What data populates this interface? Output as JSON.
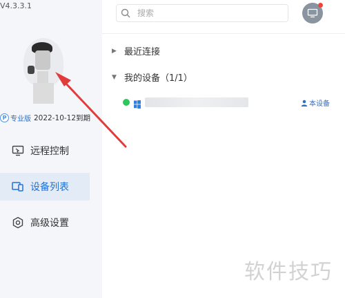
{
  "app": {
    "version": "V4.3.3.1"
  },
  "profile": {
    "plan_badge": "P",
    "plan_label": "专业版",
    "expiry": "2022-10-12到期"
  },
  "nav": {
    "remote_control": "远程控制",
    "device_list": "设备列表",
    "advanced_settings": "高级设置",
    "active": "device_list"
  },
  "search": {
    "placeholder": "搜索"
  },
  "groups": {
    "recent": {
      "caret": "▶",
      "label": "最近连接"
    },
    "mine": {
      "caret": "▼",
      "label": "我的设备（1/1）"
    }
  },
  "device": {
    "status": "online",
    "this_device_label": "本设备"
  },
  "colors": {
    "accent": "#1f6fd6",
    "online": "#2dc65a",
    "arrow": "#e23b3b",
    "notification": "#f0443a"
  },
  "watermark": "软件技巧"
}
